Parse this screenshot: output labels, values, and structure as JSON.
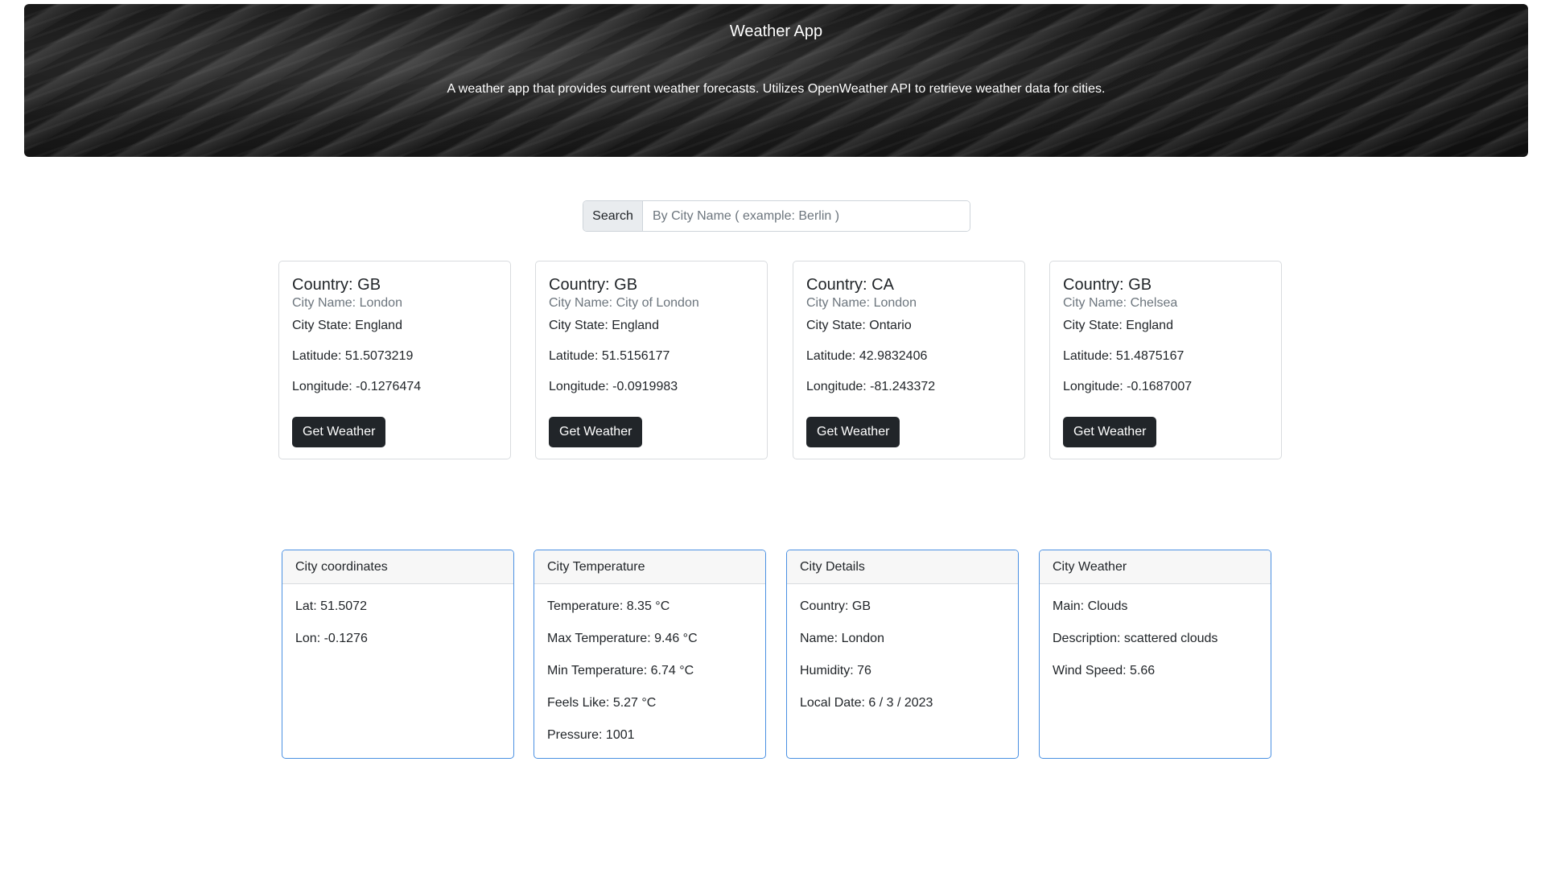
{
  "header": {
    "title": "Weather App",
    "description": "A weather app that provides current weather forecasts. Utilizes OpenWeather API to retrieve weather data for cities."
  },
  "search": {
    "label": "Search",
    "placeholder": "By City Name ( example: Berlin )",
    "value": ""
  },
  "cities": [
    {
      "country": "Country: GB",
      "name": "City Name: London",
      "state": "City State: England",
      "lat": "Latitude: 51.5073219",
      "lon": "Longitude: -0.1276474",
      "button": "Get Weather"
    },
    {
      "country": "Country: GB",
      "name": "City Name: City of London",
      "state": "City State: England",
      "lat": "Latitude: 51.5156177",
      "lon": "Longitude: -0.0919983",
      "button": "Get Weather"
    },
    {
      "country": "Country: CA",
      "name": "City Name: London",
      "state": "City State: Ontario",
      "lat": "Latitude: 42.9832406",
      "lon": "Longitude: -81.243372",
      "button": "Get Weather"
    },
    {
      "country": "Country: GB",
      "name": "City Name: Chelsea",
      "state": "City State: England",
      "lat": "Latitude: 51.4875167",
      "lon": "Longitude: -0.1687007",
      "button": "Get Weather"
    }
  ],
  "details": {
    "coordinates": {
      "title": "City coordinates",
      "rows": [
        "Lat: 51.5072",
        "Lon: -0.1276"
      ]
    },
    "temperature": {
      "title": "City Temperature",
      "rows": [
        "Temperature: 8.35 °C",
        "Max Temperature: 9.46 °C",
        "Min Temperature: 6.74 °C",
        "Feels Like: 5.27 °C",
        "Pressure: 1001"
      ]
    },
    "city": {
      "title": "City Details",
      "rows": [
        "Country: GB",
        "Name: London",
        "Humidity: 76",
        "Local Date: 6 / 3 / 2023"
      ]
    },
    "weather": {
      "title": "City Weather",
      "rows": [
        "Main: Clouds",
        "Description: scattered clouds",
        "Wind Speed: 5.66"
      ]
    }
  },
  "colors": {
    "button_bg": "#212529",
    "info_border": "#4a90e2"
  }
}
